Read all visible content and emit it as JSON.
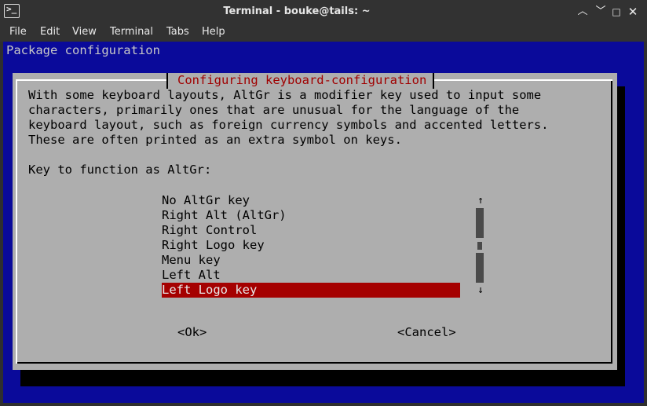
{
  "window": {
    "title": "Terminal - bouke@tails: ~",
    "icon": "terminal-icon",
    "controls": [
      "minimize-icon",
      "restore-icon",
      "maximize-icon",
      "close-icon"
    ]
  },
  "menubar": [
    "File",
    "Edit",
    "View",
    "Terminal",
    "Tabs",
    "Help"
  ],
  "terminal": {
    "header": "Package configuration",
    "dialog": {
      "title": "Configuring keyboard-configuration",
      "description": [
        "With some keyboard layouts, AltGr is a modifier key used to input some",
        "characters, primarily ones that are unusual for the language of the",
        "keyboard layout, such as foreign currency symbols and accented letters.",
        "These are often printed as an extra symbol on keys."
      ],
      "prompt": "Key to function as AltGr:",
      "options": [
        "No AltGr key",
        "Right Alt (AltGr)",
        "Right Control",
        "Right Logo key",
        "Menu key",
        "Left Alt",
        "Left Logo key"
      ],
      "selected_index": 6,
      "ok_label": "<Ok>",
      "cancel_label": "<Cancel>"
    },
    "colors": {
      "background": "#0a0a9a",
      "dialog": "#aeaeae",
      "title_text": "#a00000",
      "selection": "#a50000"
    }
  }
}
